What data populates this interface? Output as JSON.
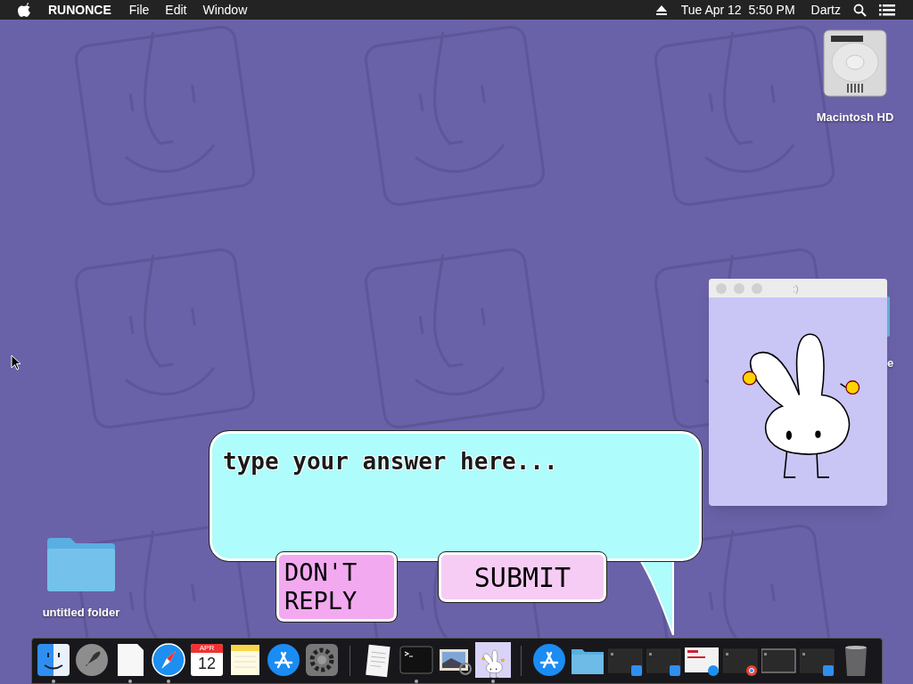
{
  "menu_bar": {
    "app_name": "RUNONCE",
    "menus": [
      "File",
      "Edit",
      "Window"
    ],
    "clock": "Tue Apr 12  5:50 PM",
    "user": "Dartz"
  },
  "desktop_icons": [
    {
      "kind": "drive",
      "label": "Macintosh HD"
    },
    {
      "kind": "folder",
      "label": "untitled folder"
    },
    {
      "kind": "partial",
      "label": "e"
    }
  ],
  "bunny_window": {
    "title": ":)",
    "active": false
  },
  "answer_dialog": {
    "placeholder": "type your answer here...",
    "buttons": [
      {
        "kind": "decline",
        "label": "DON'T REPLY"
      },
      {
        "kind": "submit",
        "label": "SUBMIT"
      }
    ]
  },
  "dock": {
    "items": [
      {
        "kind": "finder",
        "running": true
      },
      {
        "kind": "launchpad",
        "running": false
      },
      {
        "kind": "document",
        "running": true
      },
      {
        "kind": "safari",
        "running": true
      },
      {
        "kind": "calendar",
        "month": "APR",
        "day": "12",
        "running": false
      },
      {
        "kind": "notes",
        "running": false
      },
      {
        "kind": "appstore",
        "running": false
      },
      {
        "kind": "settings",
        "running": false
      },
      {
        "kind": "separator"
      },
      {
        "kind": "textedit",
        "running": false
      },
      {
        "kind": "terminal",
        "running": true
      },
      {
        "kind": "preview",
        "running": false
      },
      {
        "kind": "bunny",
        "running": true
      },
      {
        "kind": "separator"
      },
      {
        "kind": "appstore",
        "running": false
      },
      {
        "kind": "folder",
        "running": false
      },
      {
        "kind": "finderwindow",
        "running": false
      },
      {
        "kind": "finderwindow",
        "running": false
      },
      {
        "kind": "safariwindow",
        "running": false
      },
      {
        "kind": "chromewindow",
        "running": false
      },
      {
        "kind": "plainwindow",
        "running": false
      },
      {
        "kind": "finderwindow",
        "running": false
      },
      {
        "kind": "trash",
        "running": false
      }
    ]
  }
}
